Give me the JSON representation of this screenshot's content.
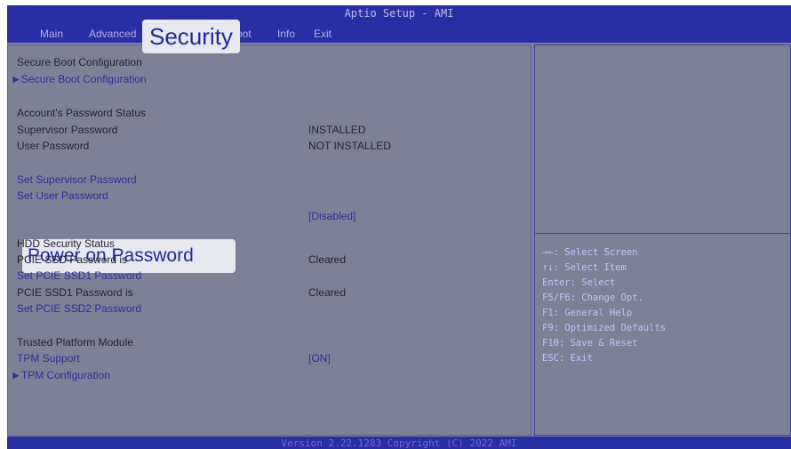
{
  "header": {
    "title": "Aptio Setup - AMI",
    "tabs": [
      {
        "label": "Main"
      },
      {
        "label": "Advanced"
      },
      {
        "label": "Security"
      },
      {
        "label": "oot"
      },
      {
        "label": "Info"
      },
      {
        "label": "Exit"
      }
    ]
  },
  "security": {
    "secure_boot_heading": "Secure Boot Configuration",
    "secure_boot_link": "Secure Boot Configuration",
    "account_status_heading": "Account's Password Status",
    "supervisor_password_label": "Supervisor Password",
    "supervisor_password_value": "INSTALLED",
    "user_password_label": "User Password",
    "user_password_value": "NOT INSTALLED",
    "set_supervisor_password": "Set Supervisor Password",
    "set_user_password": "Set User Password",
    "power_on_password_label": "Power on Password",
    "power_on_password_value": "[Disabled]",
    "hdd_security_heading": "HDD Security Status",
    "pcie_ssd_password_label": "PCIE SSD Password is",
    "pcie_ssd_password_value": "Cleared",
    "set_pcie_ssd1_password": "Set PCIE SSD1 Password",
    "pcie_ssd1_password_label": "PCIE SSD1 Password is",
    "pcie_ssd1_password_value": "Cleared",
    "set_pcie_ssd2_password": "Set PCIE SSD2 Password",
    "tpm_heading": "Trusted Platform Module",
    "tpm_support_label": "TPM Support",
    "tpm_support_value": "[ON]",
    "tpm_configuration_link": "TPM Configuration",
    "submenu_arrow": "►"
  },
  "help": [
    "→←: Select Screen",
    "↑↓: Select Item",
    "Enter: Select",
    "F5/F6: Change Opt.",
    "F1: General Help",
    "F9: Optimized Defaults",
    "F10: Save & Reset",
    "ESC: Exit"
  ],
  "footer": {
    "version": "Version 2.22.1283 Copyright (C) 2022 AMI"
  },
  "colors": {
    "header_bar": "#2a2ea4",
    "background": "#7e8196",
    "highlight": "#e8e8f1",
    "link_text": "#2b2e97"
  }
}
